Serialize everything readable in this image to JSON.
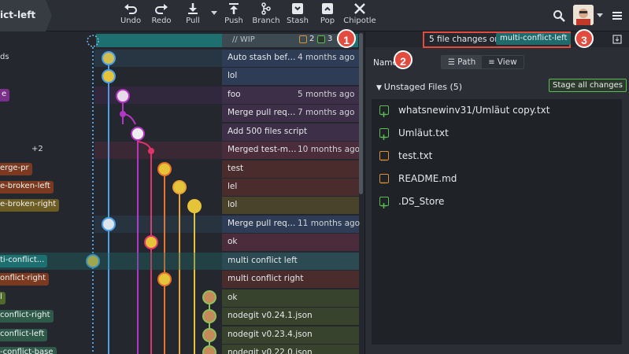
{
  "toolbar": {
    "current_branch": "ict-left",
    "buttons": [
      {
        "label": "Undo",
        "icon": "undo-icon"
      },
      {
        "label": "Redo",
        "icon": "redo-icon"
      },
      {
        "label": "Pull",
        "icon": "pull-icon"
      },
      {
        "label": "Push",
        "icon": "push-icon"
      },
      {
        "label": "Branch",
        "icon": "branch-icon"
      },
      {
        "label": "Stash",
        "icon": "stash-icon"
      },
      {
        "label": "Pop",
        "icon": "pop-icon"
      },
      {
        "label": "Chipotle",
        "icon": "chipotle-icon"
      }
    ],
    "right_icons": [
      "search-icon",
      "avatar",
      "menu-icon"
    ]
  },
  "graph": {
    "wip": {
      "label": "// WIP",
      "modified_count": "2",
      "added_count": "3"
    },
    "commits": [
      {
        "branch_label": "ds",
        "message": "Auto stash befor...",
        "time": "4 months ago"
      },
      {
        "branch_label": "",
        "message": "lol",
        "time": ""
      },
      {
        "branch_label": "e",
        "message": "foo",
        "time": "5 months ago"
      },
      {
        "branch_label": "",
        "message": "Merge pull reque...",
        "time": "7 months ago"
      },
      {
        "branch_label": "",
        "message": "Add 500 files script",
        "time": ""
      },
      {
        "branch_label": "+2",
        "message": "Merged test-me...",
        "time": "10 months ago"
      },
      {
        "branch_label": "erge-pr",
        "message": "test",
        "time": ""
      },
      {
        "branch_label": "e-broken-left",
        "message": "lel",
        "time": ""
      },
      {
        "branch_label": "e-broken-right",
        "message": "lol",
        "time": ""
      },
      {
        "branch_label": "",
        "message": "Merge pull reque...",
        "time": "11 months ago"
      },
      {
        "branch_label": "",
        "message": "ok",
        "time": ""
      },
      {
        "branch_label": "ti-conflict...",
        "message": "multi conflict left",
        "time": ""
      },
      {
        "branch_label": "onflict-right",
        "message": "multi conflict right",
        "time": ""
      },
      {
        "branch_label": "l",
        "message": "ok",
        "time": ""
      },
      {
        "branch_label": "conflict-right",
        "message": "nodegit v0.24.1.json",
        "time": ""
      },
      {
        "branch_label": "conflict-left",
        "message": "nodegit v0.23.4.json",
        "time": ""
      },
      {
        "branch_label": "-conflict-base",
        "message": "nodegit v0.22.0.json",
        "time": ""
      }
    ]
  },
  "right_panel": {
    "changes_summary": "5 file changes on",
    "branch": "multi-conflict-left",
    "name_label": "Name",
    "view_toggle": {
      "path_label": "Path",
      "view_label": "View"
    },
    "unstaged_title": "Unstaged Files (5)",
    "stage_all_label": "Stage all changes",
    "files": [
      {
        "name": "whatsnewinv31/Umläut copy.txt",
        "status": "added"
      },
      {
        "name": "Umläut.txt",
        "status": "added"
      },
      {
        "name": "test.txt",
        "status": "modified"
      },
      {
        "name": "README.md",
        "status": "modified"
      },
      {
        "name": ".DS_Store",
        "status": "added"
      }
    ]
  },
  "callouts": [
    "1",
    "2",
    "3"
  ],
  "colors": {
    "accent_teal": "#1e6f70",
    "added_green": "#5dba54",
    "modified_orange": "#d9923a",
    "callout_red": "#e34b3f"
  }
}
